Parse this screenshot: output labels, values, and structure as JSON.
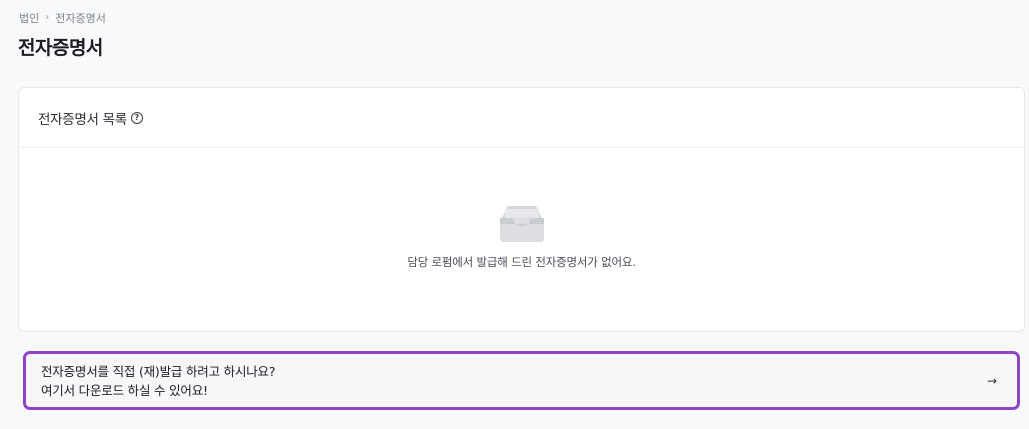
{
  "breadcrumb": {
    "parent": "법인",
    "current": "전자증명서"
  },
  "page": {
    "title": "전자증명서"
  },
  "certificate_list": {
    "title": "전자증명서 목록",
    "help_icon": "question-circle-icon",
    "empty_message": "담당 로펌에서 발급해 드린 전자증명서가 없어요.",
    "empty_icon": "empty-tray-icon"
  },
  "cta": {
    "line1": "전자증명서를 직접 (재)발급 하려고 하시나요?",
    "line2": "여기서 다운로드 하실 수 있어요!",
    "arrow_icon": "arrow-right-icon",
    "highlight_color": "#8e44c4"
  }
}
